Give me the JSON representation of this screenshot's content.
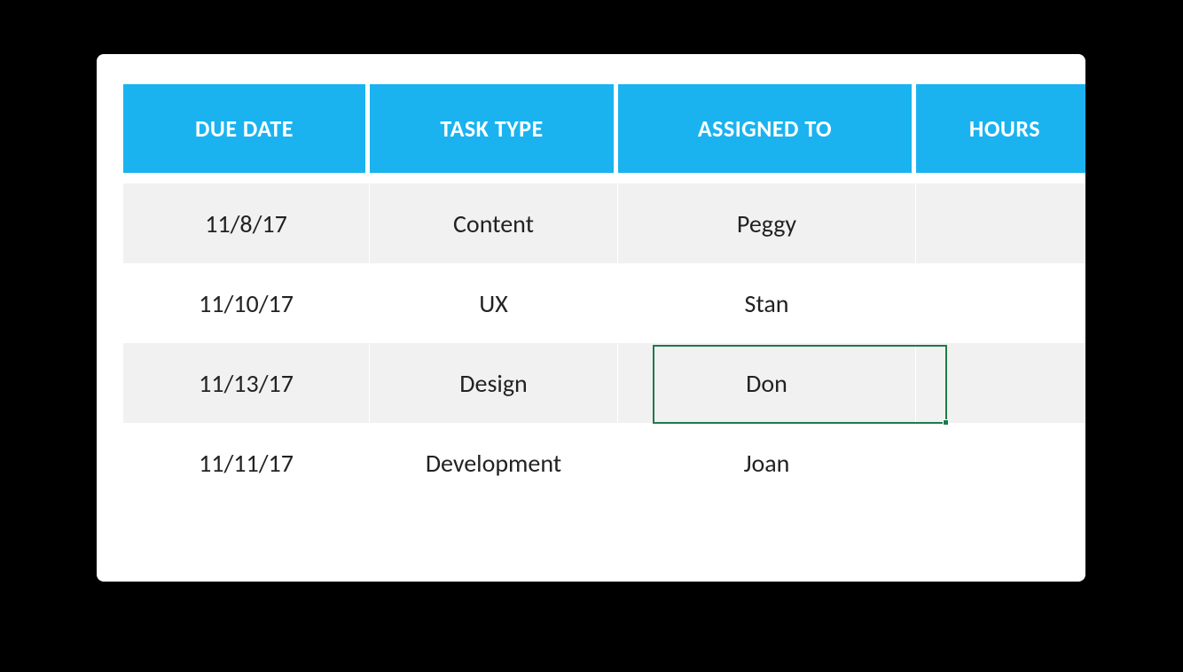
{
  "table": {
    "headers": [
      "DUE DATE",
      "TASK TYPE",
      "ASSIGNED TO",
      "HOURS"
    ],
    "rows": [
      {
        "due_date": "11/8/17",
        "task_type": "Content",
        "assigned_to": "Peggy",
        "hours": ""
      },
      {
        "due_date": "11/10/17",
        "task_type": "UX",
        "assigned_to": "Stan",
        "hours": ""
      },
      {
        "due_date": "11/13/17",
        "task_type": "Design",
        "assigned_to": "Don",
        "hours": ""
      },
      {
        "due_date": "11/11/17",
        "task_type": "Development",
        "assigned_to": "Joan",
        "hours": ""
      }
    ],
    "selected_cell": {
      "row": 2,
      "col": 2
    }
  }
}
